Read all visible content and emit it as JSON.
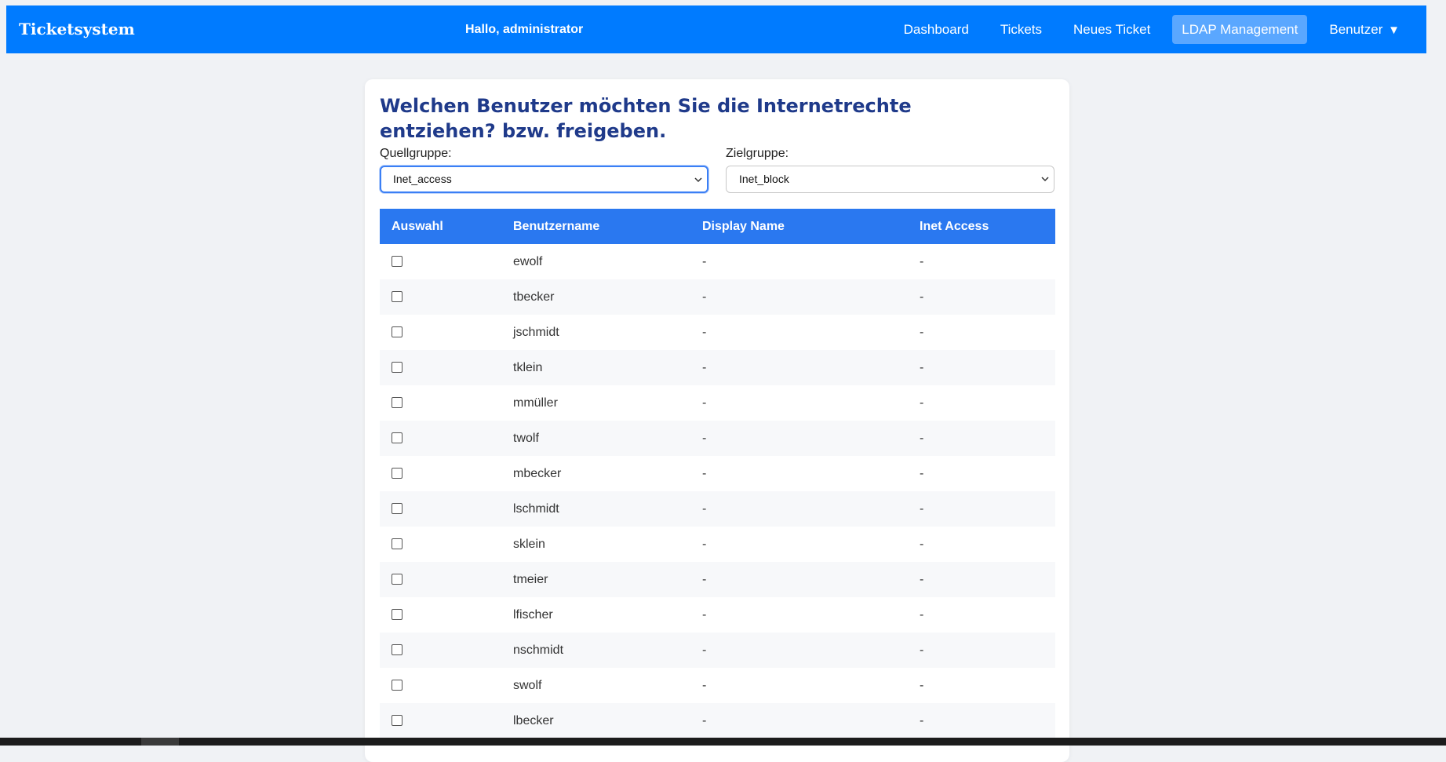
{
  "navbar": {
    "brand": "Ticketsystem",
    "greeting": "Hallo, administrator",
    "links": [
      {
        "label": "Dashboard",
        "active": false
      },
      {
        "label": "Tickets",
        "active": false
      },
      {
        "label": "Neues Ticket",
        "active": false
      },
      {
        "label": "LDAP Management",
        "active": true
      },
      {
        "label": "Benutzer",
        "active": false
      }
    ],
    "user_menu_caret": "▼",
    "colors": {
      "background": "#007bff",
      "active_link": "#5aa7ff"
    }
  },
  "main": {
    "title": "Welchen Benutzer möchten Sie die Internetrechte entziehen? bzw. freigeben.",
    "source_group": {
      "label": "Quellgruppe:",
      "value": "Inet_access"
    },
    "target_group": {
      "label": "Zielgruppe:",
      "value": "Inet_block"
    },
    "table": {
      "headers": [
        "Auswahl",
        "Benutzername",
        "Display Name",
        "Inet Access"
      ],
      "rows": [
        {
          "username": "ewolf",
          "display_name": "-",
          "inet_access": "-"
        },
        {
          "username": "tbecker",
          "display_name": "-",
          "inet_access": "-"
        },
        {
          "username": "jschmidt",
          "display_name": "-",
          "inet_access": "-"
        },
        {
          "username": "tklein",
          "display_name": "-",
          "inet_access": "-"
        },
        {
          "username": "mmüller",
          "display_name": "-",
          "inet_access": "-"
        },
        {
          "username": "twolf",
          "display_name": "-",
          "inet_access": "-"
        },
        {
          "username": "mbecker",
          "display_name": "-",
          "inet_access": "-"
        },
        {
          "username": "lschmidt",
          "display_name": "-",
          "inet_access": "-"
        },
        {
          "username": "sklein",
          "display_name": "-",
          "inet_access": "-"
        },
        {
          "username": "tmeier",
          "display_name": "-",
          "inet_access": "-"
        },
        {
          "username": "lfischer",
          "display_name": "-",
          "inet_access": "-"
        },
        {
          "username": "nschmidt",
          "display_name": "-",
          "inet_access": "-"
        },
        {
          "username": "swolf",
          "display_name": "-",
          "inet_access": "-"
        },
        {
          "username": "lbecker",
          "display_name": "-",
          "inet_access": "-"
        }
      ],
      "colors": {
        "header": "#2a78f0",
        "title": "#1f3a8a"
      }
    }
  }
}
